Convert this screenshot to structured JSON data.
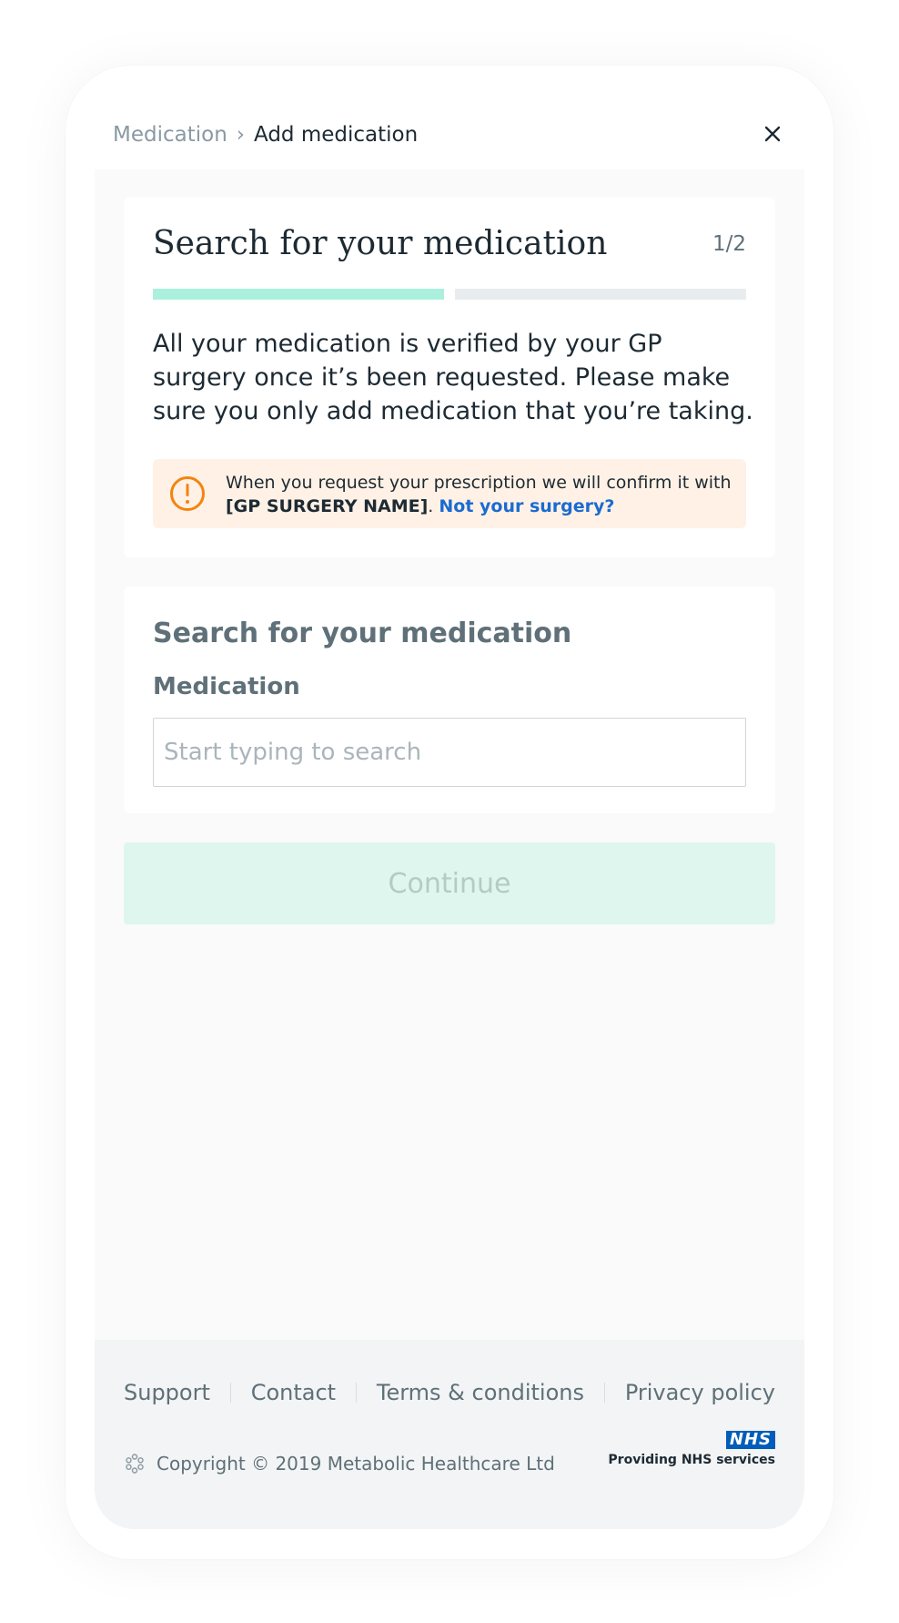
{
  "breadcrumb": {
    "parent": "Medication",
    "separator": "›",
    "current": "Add medication"
  },
  "step_card": {
    "title": "Search for your medication",
    "step_indicator": "1/2",
    "progress": {
      "current_step": 1,
      "total_steps": 2
    },
    "intro": "All your medication is verified by your GP surgery once it’s been requested. Please make sure you only add medication that you’re taking."
  },
  "alert": {
    "text_before": "When you request your prescription we will confirm it with ",
    "surgery_name": "[GP SURGERY NAME]",
    "text_after": ". ",
    "link": "Not your surgery?",
    "icon": "exclamation-circle-icon",
    "color": "#f5830f"
  },
  "search_card": {
    "heading": "Search for your medication",
    "field_label": "Medication",
    "placeholder": "Start typing to search",
    "value": ""
  },
  "continue_label": "Continue",
  "footer": {
    "links": [
      "Support",
      "Contact",
      "Terms & conditions",
      "Privacy policy"
    ],
    "copyright": "Copyright © 2019 Metabolic Healthcare Ltd",
    "nhs_logo": "NHS",
    "nhs_caption": "Providing NHS services"
  },
  "colors": {
    "accent": "#aaf0dc",
    "link": "#1a6bd1",
    "nhs_blue": "#005eb8"
  }
}
